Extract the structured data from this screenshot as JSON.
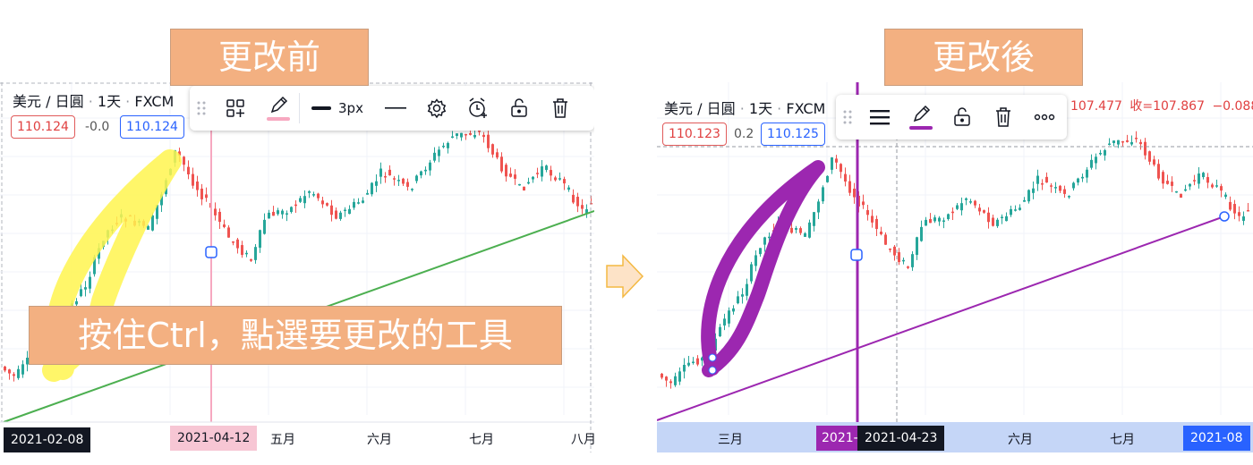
{
  "labels": {
    "before": "更改前",
    "after": "更改後",
    "instruction": "按住Ctrl，點選要更改的工具"
  },
  "left_chart": {
    "symbol": {
      "currency": "美元",
      "sep": "/",
      "quote": "日圓",
      "interval": "1天",
      "exchange": "FXCM"
    },
    "prices": {
      "bid": "110.124",
      "change": "-0.0",
      "ask": "110.124"
    },
    "toolbar": {
      "width_label": "3px"
    },
    "date_tags": {
      "start": "2021-02-08",
      "mid": "2021-04-12"
    },
    "months": [
      "五月",
      "六月",
      "七月",
      "八月"
    ],
    "colors": {
      "highlighter": "#fff44f",
      "trendline": "#4caf50",
      "vline": "#f7a8c0",
      "up": "#26a69a",
      "down": "#ef5350"
    }
  },
  "right_chart": {
    "symbol": {
      "currency": "美元",
      "sep": "/",
      "quote": "日圓",
      "interval": "1天",
      "exchange": "FXCM"
    },
    "ohlc_partial": "107.477",
    "close_label": "收=107.867",
    "change": "−0.088",
    "prices": {
      "bid": "110.123",
      "change": "0.2",
      "ask": "110.125"
    },
    "date_tags": {
      "a": "2021-",
      "b": "2021-04-23",
      "c": "2021-08"
    },
    "months": [
      "三月",
      "六月",
      "七月"
    ],
    "colors": {
      "drawing": "#9c27b0",
      "axis_bg": "#c5d6f7"
    }
  }
}
